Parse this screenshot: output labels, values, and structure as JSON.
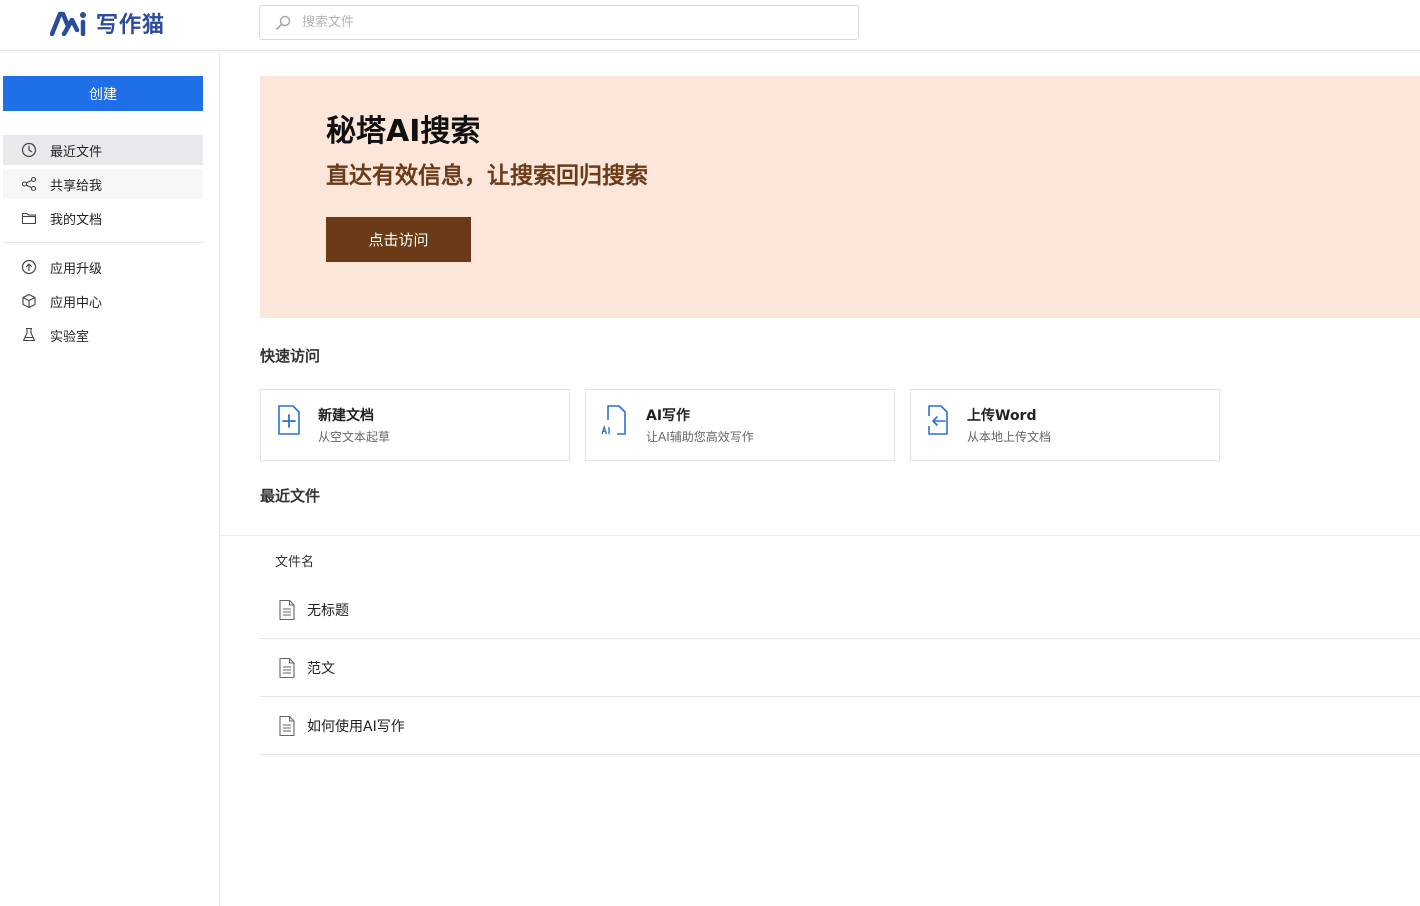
{
  "app": {
    "name": "写作猫",
    "brand_color": "#2b4b9b",
    "accent_color": "#1f6fe8"
  },
  "search": {
    "placeholder": "搜索文件",
    "icon": "search-icon"
  },
  "sidebar": {
    "create_label": "创建",
    "items": [
      {
        "label": "最近文件",
        "icon": "clock-icon",
        "state": "active"
      },
      {
        "label": "共享给我",
        "icon": "share-icon",
        "state": "hover"
      },
      {
        "label": "我的文档",
        "icon": "folder-icon",
        "state": "normal"
      },
      {
        "label": "应用升级",
        "icon": "upgrade-icon",
        "state": "normal"
      },
      {
        "label": "应用中心",
        "icon": "box-icon",
        "state": "normal"
      },
      {
        "label": "实验室",
        "icon": "flask-icon",
        "state": "normal"
      }
    ]
  },
  "banner": {
    "title": "秘塔AI搜索",
    "subtitle": "直达有效信息，让搜索回归搜索",
    "button_label": "点击访问",
    "bg_color": "#fce6da",
    "button_color": "#6b3a17"
  },
  "quick_access": {
    "title": "快速访问",
    "cards": [
      {
        "title": "新建文档",
        "desc": "从空文本起草",
        "icon": "new-doc-icon"
      },
      {
        "title": "AI写作",
        "desc": "让AI辅助您高效写作",
        "icon": "ai-doc-icon"
      },
      {
        "title": "上传Word",
        "desc": "从本地上传文档",
        "icon": "upload-doc-icon"
      }
    ]
  },
  "recent": {
    "title": "最近文件",
    "column_header": "文件名",
    "files": [
      {
        "name": "无标题",
        "icon": "document-icon"
      },
      {
        "name": "范文",
        "icon": "document-icon"
      },
      {
        "name": "如何使用AI写作",
        "icon": "document-icon"
      }
    ]
  }
}
